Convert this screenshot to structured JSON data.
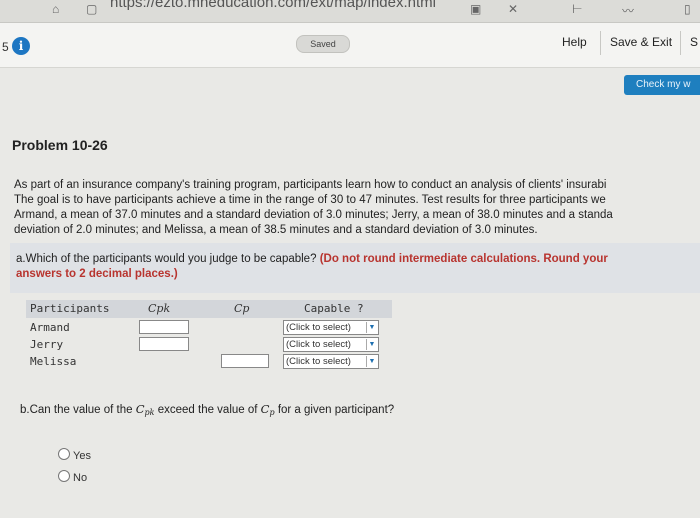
{
  "browser": {
    "url": "https://ezto.mheducation.com/ext/map/index.html"
  },
  "header": {
    "question_number": "5",
    "saved_label": "Saved",
    "help_label": "Help",
    "save_exit_label": "Save & Exit",
    "submit_label": "S",
    "check_label": "Check my w"
  },
  "problem": {
    "title": "Problem 10-26",
    "paragraph_lines": [
      "As part of an insurance company's training program, participants learn how to conduct an analysis of clients' insurabi",
      "The goal is to have participants achieve a time in the range of 30 to 47 minutes. Test results for three participants we",
      "Armand, a mean of 37.0 minutes and a standard deviation of 3.0 minutes; Jerry, a mean of 38.0 minutes and a standa",
      "deviation of 2.0 minutes; and Melissa, a mean of 38.5 minutes and a standard deviation of 3.0 minutes."
    ]
  },
  "part_a": {
    "question": "a.Which of the participants would you judge to be capable?",
    "instruction_l1": "(Do not round intermediate calculations. Round your",
    "instruction_l2": "answers to 2 decimal places.)",
    "table": {
      "headers": [
        "Participants",
        "Cpk",
        "Cp",
        "Capable ?"
      ],
      "rows": [
        {
          "name": "Armand",
          "select": "(Click to select)"
        },
        {
          "name": "Jerry",
          "select": "(Click to select)"
        },
        {
          "name": "Melissa",
          "select": "(Click to select)"
        }
      ]
    }
  },
  "part_b": {
    "q_prefix": "b.Can the value of the",
    "cpk": "C",
    "cpk_sub": "pk",
    "q_mid": "exceed the value of",
    "cp": "C",
    "cp_sub": "p",
    "q_suffix": "for a given participant?",
    "options": [
      "Yes",
      "No"
    ]
  }
}
